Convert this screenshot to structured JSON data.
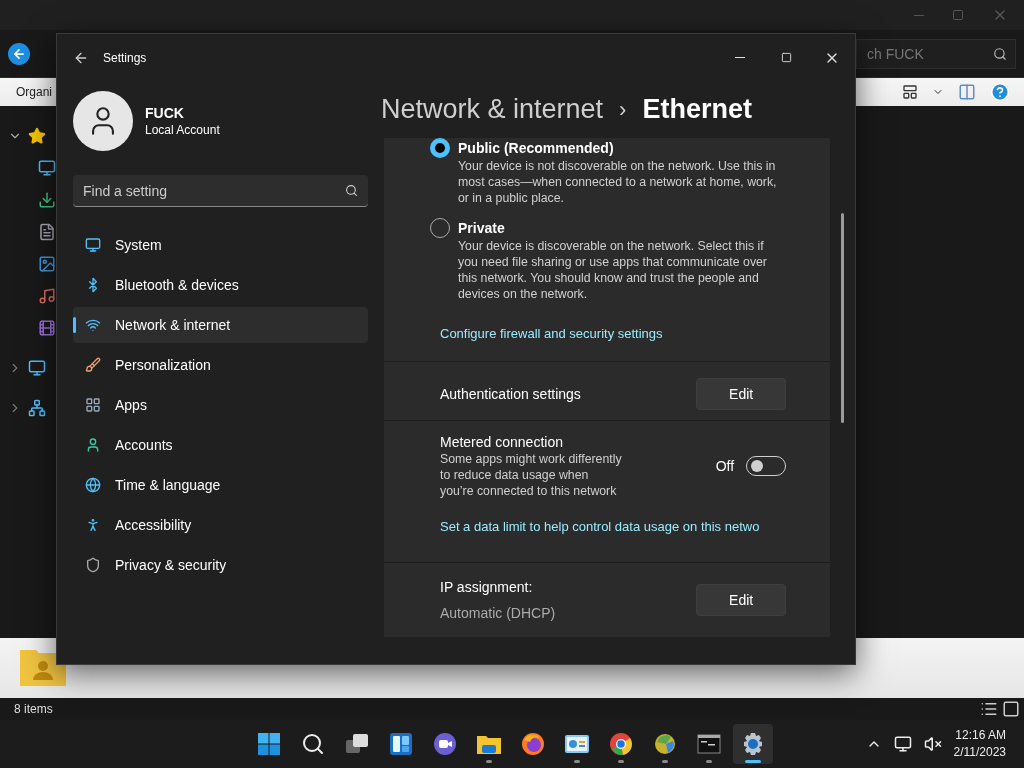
{
  "explorer": {
    "search_placeholder": "ch FUCK",
    "ribbon_label": "Organi",
    "tree": [
      {
        "expanded": true,
        "kind": "star",
        "children": [
          {
            "kind": "desktop"
          },
          {
            "kind": "downloads"
          },
          {
            "kind": "documents"
          },
          {
            "kind": "pictures"
          },
          {
            "kind": "music"
          },
          {
            "kind": "videos"
          }
        ]
      },
      {
        "expanded": false,
        "kind": "pc"
      },
      {
        "expanded": false,
        "kind": "network"
      }
    ],
    "status": "8 items"
  },
  "settings": {
    "title": "Settings",
    "user": {
      "name": "FUCK",
      "account": "Local Account"
    },
    "search_placeholder": "Find a setting",
    "nav": [
      {
        "label": "System",
        "selected": false
      },
      {
        "label": "Bluetooth & devices",
        "selected": false
      },
      {
        "label": "Network & internet",
        "selected": true
      },
      {
        "label": "Personalization",
        "selected": false
      },
      {
        "label": "Apps",
        "selected": false
      },
      {
        "label": "Accounts",
        "selected": false
      },
      {
        "label": "Time & language",
        "selected": false
      },
      {
        "label": "Accessibility",
        "selected": false
      },
      {
        "label": "Privacy & security",
        "selected": false
      }
    ],
    "breadcrumb": {
      "parent": "Network & internet",
      "separator": "›",
      "current": "Ethernet"
    },
    "profiles": [
      {
        "label": "Public (Recommended)",
        "description": "Your device is not discoverable on the network. Use this in most cases—when connected to a network at home, work, or in a public place.",
        "selected": true
      },
      {
        "label": "Private",
        "description": "Your device is discoverable on the network. Select this if you need file sharing or use apps that communicate over this network. You should know and trust the people and devices on the network.",
        "selected": false
      }
    ],
    "firewall_link": "Configure firewall and security settings",
    "authentication": {
      "label": "Authentication settings",
      "button": "Edit"
    },
    "metered": {
      "label": "Metered connection",
      "description": "Some apps might work differently to reduce data usage when you’re connected to this network",
      "state_label": "Off",
      "on": false
    },
    "data_limit_link": "Set a data limit to help control data usage on this netwo",
    "ip": {
      "label": "IP assignment:",
      "value": "Automatic (DHCP)",
      "button": "Edit"
    }
  },
  "taskbar": {
    "apps": [
      {
        "kind": "start",
        "running": false,
        "active": false
      },
      {
        "kind": "search",
        "running": false,
        "active": false
      },
      {
        "kind": "taskview",
        "running": false,
        "active": false
      },
      {
        "kind": "widgets",
        "running": false,
        "active": false
      },
      {
        "kind": "chat",
        "running": false,
        "active": false
      },
      {
        "kind": "explorer",
        "running": true,
        "active": false
      },
      {
        "kind": "firefox",
        "running": false,
        "active": false
      },
      {
        "kind": "controlpanel",
        "running": true,
        "active": false
      },
      {
        "kind": "chrome",
        "running": true,
        "active": false
      },
      {
        "kind": "ball",
        "running": true,
        "active": false
      },
      {
        "kind": "terminal",
        "running": true,
        "active": false
      },
      {
        "kind": "settings",
        "running": true,
        "active": true
      }
    ],
    "time": "12:16 AM",
    "date": "2/11/2023"
  }
}
